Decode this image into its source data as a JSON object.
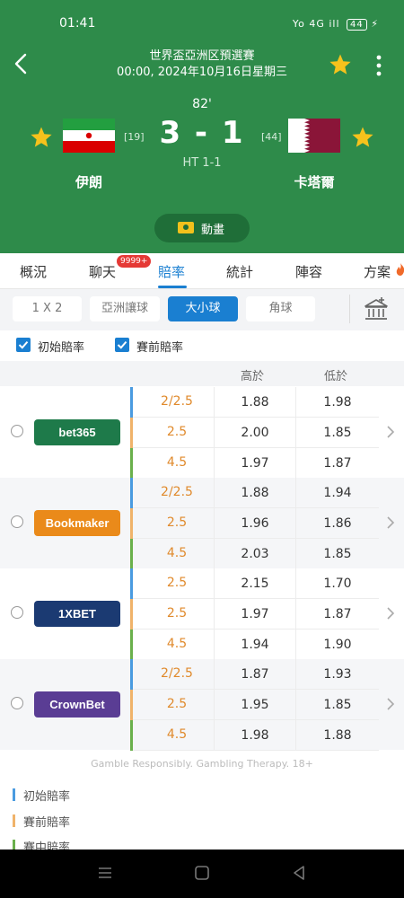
{
  "status_bar": {
    "time": "01:41",
    "signal": "Yo 4G ill",
    "battery": "44"
  },
  "match": {
    "league": "世界盃亞洲区預選賽",
    "datetime": "00:00, 2024年10月16日星期三",
    "minute": "82'",
    "score": "3 - 1",
    "half_time": "HT 1-1",
    "home": {
      "name": "伊朗",
      "rank": "[19]"
    },
    "away": {
      "name": "卡塔爾",
      "rank": "[44]"
    },
    "animation_label": "動畫"
  },
  "tabs": [
    {
      "label": "概況"
    },
    {
      "label": "聊天",
      "badge": "9999+"
    },
    {
      "label": "賠率",
      "active": true
    },
    {
      "label": "統計"
    },
    {
      "label": "陣容"
    },
    {
      "label": "方案"
    }
  ],
  "subtabs": [
    {
      "label": "1 X 2"
    },
    {
      "label": "亞洲讓球"
    },
    {
      "label": "大小球",
      "active": true
    },
    {
      "label": "角球"
    }
  ],
  "checkboxes": [
    {
      "label": "初始賠率",
      "checked": true
    },
    {
      "label": "賽前賠率",
      "checked": true
    }
  ],
  "table_header": {
    "over": "高於",
    "under": "低於"
  },
  "colors": {
    "initial": "#4a9be0",
    "pre_match": "#f0b36a",
    "live": "#6ab04c"
  },
  "bookmakers": [
    {
      "name": "bet365",
      "color": "#1e7a4a",
      "rows": [
        {
          "line": "2/2.5",
          "over": "1.88",
          "under": "1.98"
        },
        {
          "line": "2.5",
          "over": "2.00",
          "under": "1.85"
        },
        {
          "line": "4.5",
          "over": "1.97",
          "under": "1.87"
        }
      ]
    },
    {
      "name": "Bookmaker",
      "color": "#ea8a1a",
      "rows": [
        {
          "line": "2/2.5",
          "over": "1.88",
          "under": "1.94"
        },
        {
          "line": "2.5",
          "over": "1.96",
          "under": "1.86"
        },
        {
          "line": "4.5",
          "over": "2.03",
          "under": "1.85"
        }
      ]
    },
    {
      "name": "1XBET",
      "color": "#1b3a72",
      "rows": [
        {
          "line": "2.5",
          "over": "2.15",
          "under": "1.70"
        },
        {
          "line": "2.5",
          "over": "1.97",
          "under": "1.87"
        },
        {
          "line": "4.5",
          "over": "1.94",
          "under": "1.90"
        }
      ]
    },
    {
      "name": "CrownBet",
      "color": "#5a3d94",
      "rows": [
        {
          "line": "2/2.5",
          "over": "1.87",
          "under": "1.93"
        },
        {
          "line": "2.5",
          "over": "1.95",
          "under": "1.85"
        },
        {
          "line": "4.5",
          "over": "1.98",
          "under": "1.88"
        }
      ]
    }
  ],
  "disclaimer": "Gamble Responsibly. Gambling Therapy. 18+",
  "legend": [
    {
      "label": "初始賠率"
    },
    {
      "label": "賽前賠率"
    },
    {
      "label": "賽中賠率"
    }
  ]
}
